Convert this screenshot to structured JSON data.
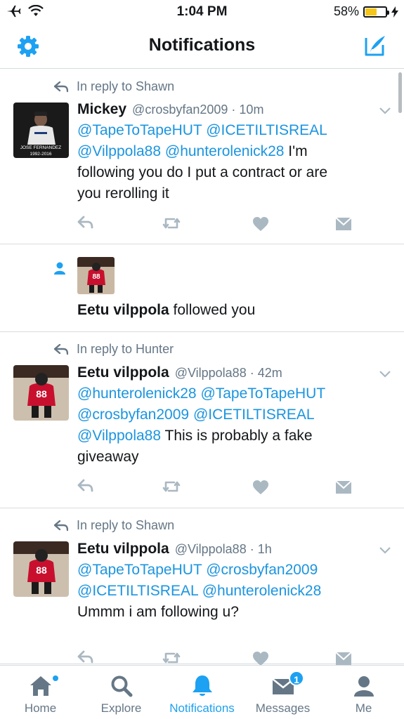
{
  "status_bar": {
    "time": "1:04 PM",
    "battery_percent": "58%",
    "battery_level": 0.58
  },
  "header": {
    "title": "Notifications",
    "settings_icon": "gear-icon",
    "compose_icon": "compose-icon"
  },
  "colors": {
    "accent": "#1da1f2",
    "mention": "#1b95e0",
    "secondary_text": "#657786",
    "action_icon": "#aab8c2"
  },
  "notifications": [
    {
      "type": "reply",
      "reply_context": "In reply to Shawn",
      "name": "Mickey",
      "handle": "@crosbyfan2009",
      "time": "· 10m",
      "avatar_caption_1": "JOSE FERNANDEZ",
      "avatar_caption_2": "1992-2016",
      "lines": [
        [
          {
            "t": "@TapeToTapeHUT",
            "m": true
          },
          {
            "t": " ",
            "m": false
          },
          {
            "t": "@ICETILTISREAL",
            "m": true
          }
        ],
        [
          {
            "t": "@Vilppola88",
            "m": true
          },
          {
            "t": " ",
            "m": false
          },
          {
            "t": "@hunterolenick28",
            "m": true
          },
          {
            "t": " I'm",
            "m": false
          }
        ],
        [
          {
            "t": "following you do I put a contract or are",
            "m": false
          }
        ],
        [
          {
            "t": "you rerolling it",
            "m": false
          }
        ]
      ]
    },
    {
      "type": "follow",
      "name": "Eetu vilppola",
      "text": " followed you"
    },
    {
      "type": "reply",
      "reply_context": "In reply to Hunter",
      "name": "Eetu vilppola",
      "handle": "@Vilppola88",
      "time": "· 42m",
      "lines": [
        [
          {
            "t": "@hunterolenick28",
            "m": true
          },
          {
            "t": " ",
            "m": false
          },
          {
            "t": "@TapeToTapeHUT",
            "m": true
          }
        ],
        [
          {
            "t": "@crosbyfan2009",
            "m": true
          },
          {
            "t": " ",
            "m": false
          },
          {
            "t": "@ICETILTISREAL",
            "m": true
          }
        ],
        [
          {
            "t": "@Vilppola88",
            "m": true
          },
          {
            "t": " This is probably a fake",
            "m": false
          }
        ],
        [
          {
            "t": "giveaway",
            "m": false
          }
        ]
      ]
    },
    {
      "type": "reply",
      "reply_context": "In reply to Shawn",
      "name": "Eetu vilppola",
      "handle": "@Vilppola88",
      "time": "· 1h",
      "lines": [
        [
          {
            "t": "@TapeToTapeHUT",
            "m": true
          },
          {
            "t": " ",
            "m": false
          },
          {
            "t": "@crosbyfan2009",
            "m": true
          }
        ],
        [
          {
            "t": "@ICETILTISREAL",
            "m": true
          },
          {
            "t": " ",
            "m": false
          },
          {
            "t": "@hunterolenick28",
            "m": true
          }
        ],
        [
          {
            "t": "Ummm i am following u?",
            "m": false
          }
        ]
      ]
    }
  ],
  "tab_bar": {
    "home": "Home",
    "explore": "Explore",
    "notifications": "Notifications",
    "messages": "Messages",
    "me": "Me",
    "messages_badge": "1"
  }
}
